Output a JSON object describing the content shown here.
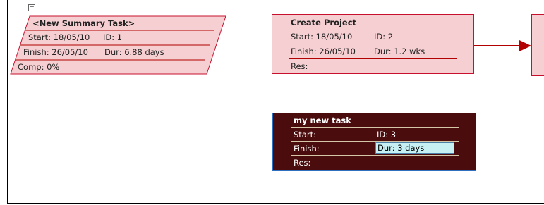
{
  "toggle": {
    "symbol": "−"
  },
  "summary_task": {
    "name": "<New Summary Task>",
    "start_label": "Start:",
    "start_value": "18/05/10",
    "id_label": "ID:",
    "id_value": "1",
    "finish_label": "Finish:",
    "finish_value": "26/05/10",
    "dur_label": "Dur:",
    "dur_value": "6.88 days",
    "comp_label": "Comp:",
    "comp_value": "0%"
  },
  "create_project": {
    "name": "Create Project",
    "start_label": "Start:",
    "start_value": "18/05/10",
    "id_label": "ID:",
    "id_value": "2",
    "finish_label": "Finish:",
    "finish_value": "26/05/10",
    "dur_label": "Dur:",
    "dur_value": "1.2 wks",
    "res_label": "Res:"
  },
  "new_task": {
    "name": "my new task",
    "start_label": "Start:",
    "id_label": "ID:",
    "id_value": "3",
    "finish_label": "Finish:",
    "dur_label": "Dur:",
    "dur_value": "3 days",
    "res_label": "Res:"
  },
  "colors": {
    "node_fill": "#f6cfd2",
    "node_border": "#c8102e",
    "selected_fill": "#4a0c0c",
    "selected_border": "#2f6fbf",
    "edit_field": "#c6f0f3",
    "connector": "#b30000"
  }
}
